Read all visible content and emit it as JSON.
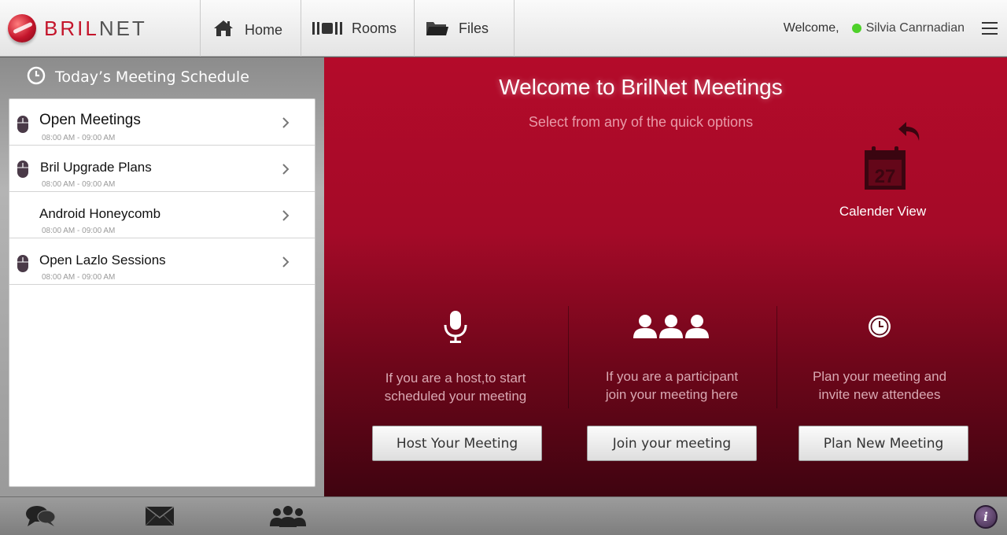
{
  "app": {
    "logo_text_red": "BRIL",
    "logo_text_dark": "NET"
  },
  "nav": {
    "home": "Home",
    "rooms": "Rooms",
    "files": "Files"
  },
  "header": {
    "welcome": "Welcome,",
    "user_name": "Silvia Canrnadian",
    "status_color": "#4ed12a"
  },
  "schedule": {
    "title": "Today’s Meeting Schedule",
    "items": [
      {
        "title": "Open Meetings",
        "time": "08:00 AM - 09:00 AM",
        "icon": "mouse-icon"
      },
      {
        "title": "Bril Upgrade Plans",
        "time": "08:00 AM - 09:00 AM",
        "icon": "mouse-icon"
      },
      {
        "title": "Android Honeycomb",
        "time": "08:00 AM - 09:00 AM",
        "icon": ""
      },
      {
        "title": "Open Lazlo Sessions",
        "time": "08:00 AM - 09:00 AM",
        "icon": "mouse-icon"
      }
    ]
  },
  "main": {
    "title": "Welcome to BrilNet Meetings",
    "subtitle": "Select from any of the quick options",
    "calendar_day": "27",
    "calendar_label": "Calender View",
    "host_desc_1": "If you are a host,to start",
    "host_desc_2": "scheduled your meeting",
    "join_desc_1": "If you are a participant",
    "join_desc_2": "join your meeting here",
    "plan_desc_1": "Plan your meeting and",
    "plan_desc_2": "invite new attendees",
    "host_button": "Host Your Meeting",
    "join_button": "Join your meeting",
    "plan_button": "Plan New Meeting"
  },
  "bottom": {
    "info_label": "i"
  },
  "colors": {
    "brand_red": "#c4152b",
    "main_bg_top": "#b40b2a",
    "main_bg_bottom": "#3f0410"
  }
}
